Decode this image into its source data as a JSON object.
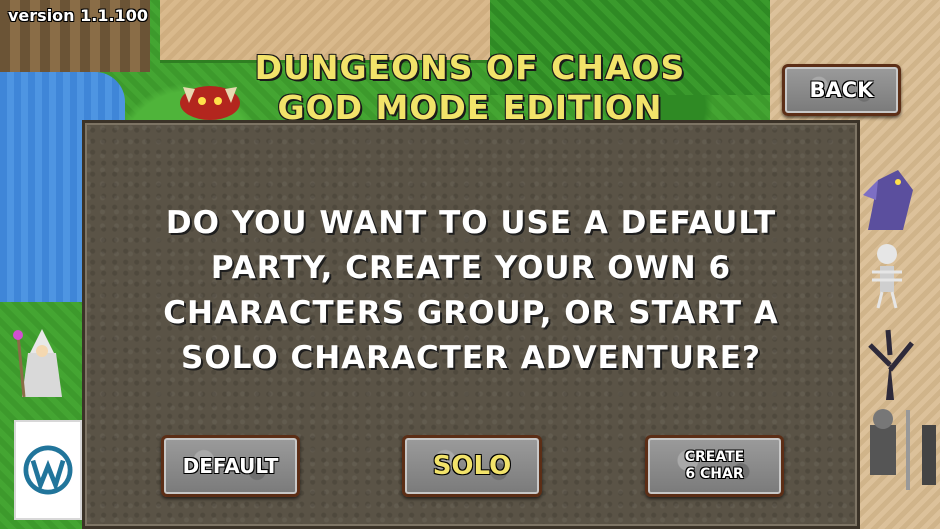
{
  "hud": {
    "version": "version 1.1.100"
  },
  "title": {
    "line1": "DUNGEONS OF CHAOS",
    "line2": "GOD MODE EDITION"
  },
  "back_button": {
    "label": "BACK"
  },
  "dialog": {
    "question_lines": [
      "DO YOU WANT TO USE A DEFAULT",
      "PARTY, CREATE YOUR OWN 6",
      "CHARACTERS GROUP, OR START A",
      "SOLO CHARACTER ADVENTURE?"
    ],
    "options": {
      "default_label": "DEFAULT",
      "solo_label": "SOLO",
      "create_label_line1": "CREATE",
      "create_label_line2": "6 CHAR"
    }
  },
  "colors": {
    "title_yellow": "#f2e36a",
    "dialog_bg": "#5a5346",
    "button_border": "#5c2e16"
  },
  "icons": [
    "wordpress-icon",
    "wizard-sprite",
    "demon-sprite",
    "dragon-sprite",
    "skeleton-sprite",
    "dead-tree-sprite",
    "knight-sprite"
  ]
}
